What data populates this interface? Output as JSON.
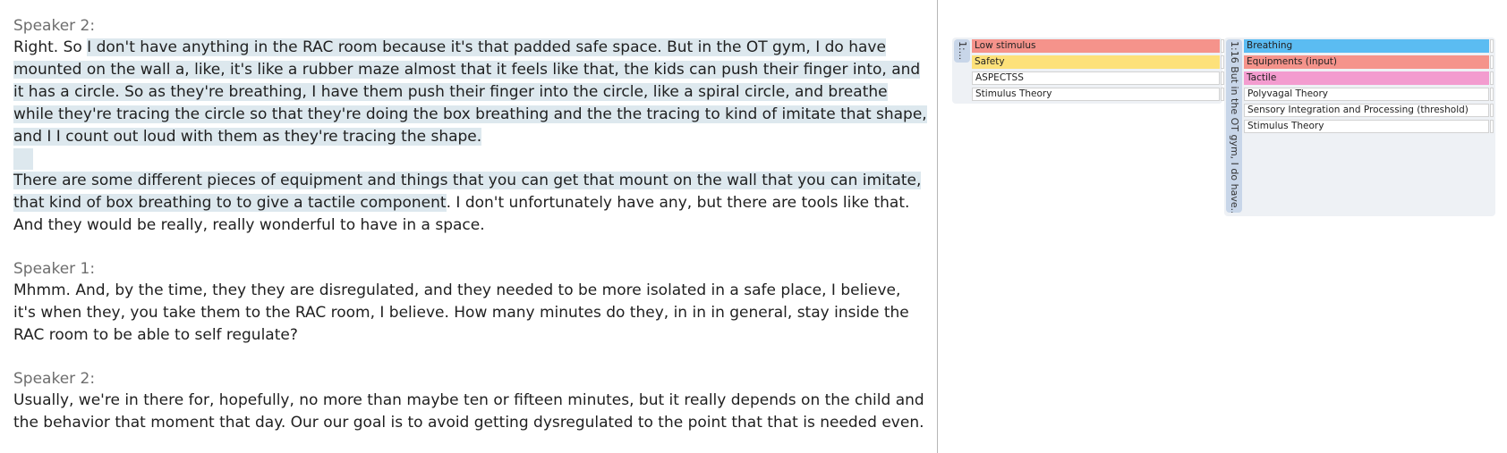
{
  "transcript": {
    "blocks": [
      {
        "speaker": "Speaker 2:",
        "paragraphs": [
          {
            "plain_start": "Right. So ",
            "highlighted": "I don't have anything in the RAC room because it's that padded safe space. But in the OT gym, I do have mounted on the wall a, like, it's like a rubber maze almost that it feels like that, the kids can push their finger into, and it has a circle. So as they're breathing, I have them push their finger into the circle, like a spiral circle, and breathe while they're tracing the circle so that they're doing the box breathing and the the tracing to kind of imitate that shape, and I I count out loud with them as they're tracing the shape.",
            "plain_end": ""
          },
          {
            "plain_start": "",
            "highlighted": "There are some different pieces of equipment and things that you can get that mount on the wall that you can imitate, that kind of box breathing to to give a tactile component",
            "plain_end": ". I don't unfortunately have any, but there are tools like that. And they would be really, really wonderful to have in a space."
          }
        ]
      },
      {
        "speaker": "Speaker 1:",
        "text": "Mhmm. And, by the time, they they are disregulated, and they needed to be more isolated in a safe place, I believe, it's when they, you take them to the RAC room, I believe. How many minutes do they, in in in general,  stay inside the RAC room to be able to self regulate?"
      },
      {
        "speaker": "Speaker 2:",
        "text": "Usually, we're in there for, hopefully, no more than maybe ten or fifteen minutes, but it really depends on the child and the behavior that moment that day. Our our goal is to avoid getting dysregulated to the point that that is needed even."
      }
    ]
  },
  "coding_panel": {
    "group_a": {
      "stripe_label": "1:...",
      "codes": [
        {
          "label": "Low stimulus",
          "color": "#f5938b"
        },
        {
          "label": "Safety",
          "color": "#fde17a"
        },
        {
          "label": "ASPECTSS",
          "color": "#ffffff"
        },
        {
          "label": "Stimulus Theory",
          "color": "#ffffff"
        }
      ]
    },
    "group_b": {
      "stripe_label": "1:16 But in the OT gym, I do have...",
      "codes": [
        {
          "label": "Breathing",
          "color": "#5bbcf2"
        },
        {
          "label": "Equipments (input)",
          "color": "#f5938b"
        },
        {
          "label": "Tactile",
          "color": "#f39ccf"
        },
        {
          "label": "Polyvagal Theory",
          "color": "#ffffff"
        },
        {
          "label": "Sensory Integration and Processing (threshold)",
          "color": "#ffffff"
        },
        {
          "label": "Stimulus Theory",
          "color": "#ffffff"
        }
      ]
    }
  }
}
